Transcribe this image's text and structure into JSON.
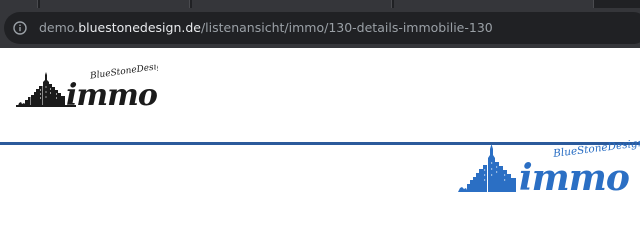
{
  "browser": {
    "url": {
      "prefix": "demo.",
      "host": "bluestonedesign.de",
      "path": "/listenansicht/immo/130-details-immobilie-130"
    }
  },
  "logo": {
    "subtitle": "BlueStoneDesign",
    "wordmark": "immo"
  },
  "colors": {
    "rule": "#2b5a9b",
    "logo_dark": "#1b1b1b",
    "logo_blue": "#2b6fc4"
  },
  "icons": {
    "site_info": "info-circle-icon"
  }
}
